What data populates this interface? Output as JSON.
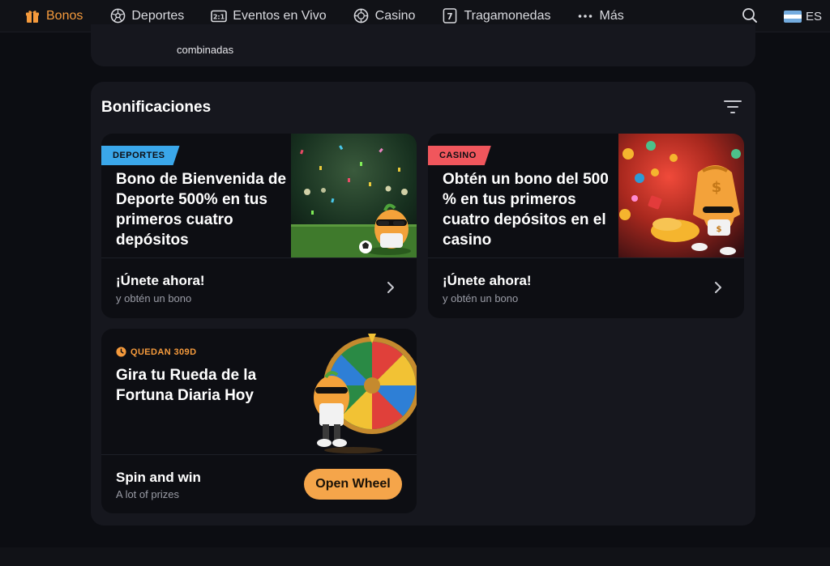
{
  "nav": {
    "items": [
      {
        "label": "Bonos",
        "icon": "gift-icon",
        "active": true
      },
      {
        "label": "Deportes",
        "icon": "soccer-ball-icon",
        "active": false
      },
      {
        "label": "Eventos en Vivo",
        "icon": "scoreboard-icon",
        "active": false
      },
      {
        "label": "Casino",
        "icon": "casino-chip-icon",
        "active": false
      },
      {
        "label": "Tragamonedas",
        "icon": "slot-seven-icon",
        "active": false
      },
      {
        "label": "Más",
        "icon": "more-dots-icon",
        "active": false
      }
    ],
    "search_icon": "search-icon",
    "language": {
      "code": "ES",
      "flag": "argentina-flag-icon"
    }
  },
  "previous_card": {
    "text": "combinadas"
  },
  "section": {
    "title": "Bonificaciones",
    "filter_icon": "filter-icon"
  },
  "cards": [
    {
      "badge": "DEPORTES",
      "badge_color": "#3aa7ea",
      "heading": "Bono de Bienvenida de Deporte 500% en tus primeros cuatro depósitos",
      "cta_title": "¡Únete ahora!",
      "cta_sub": "y obtén un bono",
      "art": "soccer-mascot-image"
    },
    {
      "badge": "CASINO",
      "badge_color": "#f0565c",
      "heading": "Obtén un bono del 500 % en tus primeros cuatro depósitos en el casino",
      "cta_title": "¡Únete ahora!",
      "cta_sub": "y obtén un bono",
      "art": "casino-coins-mascot-image"
    }
  ],
  "wheel_card": {
    "timer": "QUEDAN 309D",
    "timer_icon": "clock-icon",
    "heading": "Gira tu Rueda de la Fortuna Diaria Hoy",
    "cta_title": "Spin and win",
    "cta_sub": "A lot of prizes",
    "button": "Open Wheel",
    "art": "fortune-wheel-mascot-image"
  },
  "colors": {
    "accent": "#f59a3c",
    "button": "#f5a54a",
    "background": "#0c0d12",
    "panel": "#16171e",
    "card": "#0d0e13"
  }
}
